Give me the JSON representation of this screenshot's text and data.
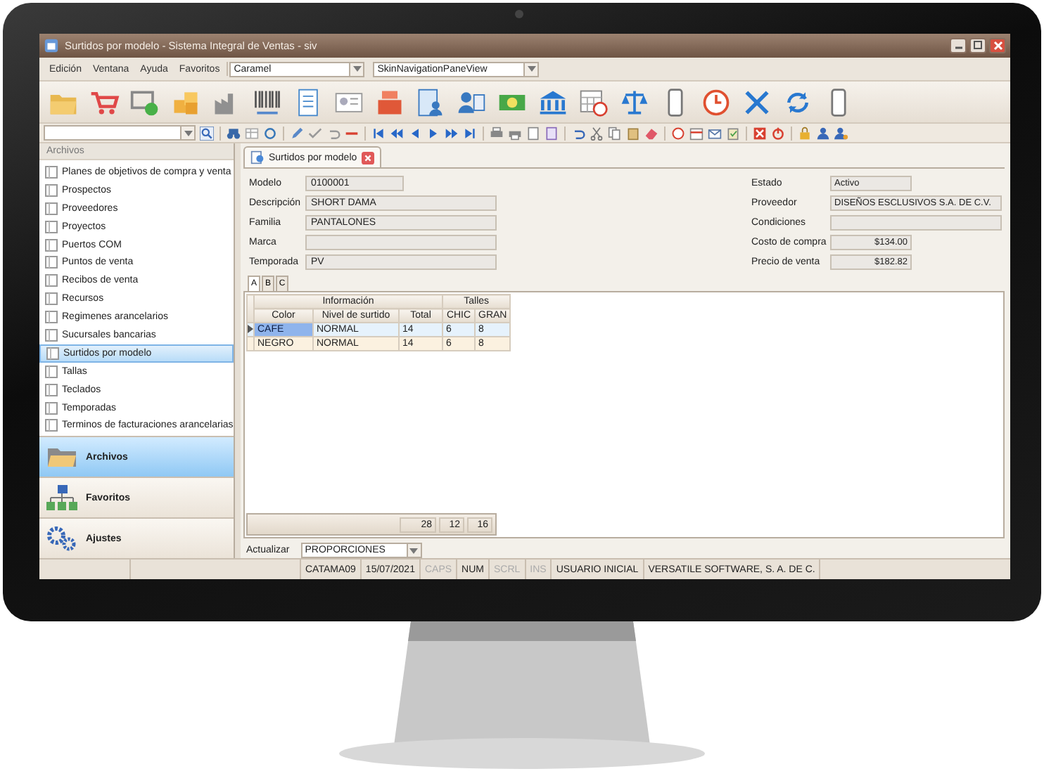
{
  "window": {
    "title": "Surtidos por modelo - Sistema Integral de Ventas - siv"
  },
  "menu": [
    "Edición",
    "Ventana",
    "Ayuda",
    "Favoritos"
  ],
  "skin_combo": {
    "value": "Caramel"
  },
  "view_combo": {
    "value": "SkinNavigationPaneView"
  },
  "sidebar": {
    "header": "Archivos",
    "items": [
      {
        "label": "Planes de objetivos de compra y venta",
        "selected": false
      },
      {
        "label": "Prospectos",
        "selected": false
      },
      {
        "label": "Proveedores",
        "selected": false
      },
      {
        "label": "Proyectos",
        "selected": false
      },
      {
        "label": "Puertos COM",
        "selected": false
      },
      {
        "label": "Puntos de venta",
        "selected": false
      },
      {
        "label": "Recibos de venta",
        "selected": false
      },
      {
        "label": "Recursos",
        "selected": false
      },
      {
        "label": "Regimenes arancelarios",
        "selected": false
      },
      {
        "label": "Sucursales bancarias",
        "selected": false
      },
      {
        "label": "Surtidos por modelo",
        "selected": true
      },
      {
        "label": "Tallas",
        "selected": false
      },
      {
        "label": "Teclados",
        "selected": false
      },
      {
        "label": "Temporadas",
        "selected": false
      },
      {
        "label": "Terminos de facturaciones arancelarias",
        "selected": false
      }
    ]
  },
  "nav_pane": [
    {
      "label": "Archivos",
      "selected": true
    },
    {
      "label": "Favoritos",
      "selected": false
    },
    {
      "label": "Ajustes",
      "selected": false
    }
  ],
  "document_tab": {
    "label": "Surtidos por modelo"
  },
  "form": {
    "left": [
      {
        "label": "Modelo",
        "value": "0100001",
        "kind": "short"
      },
      {
        "label": "Descripción",
        "value": "SHORT DAMA",
        "kind": "wide"
      },
      {
        "label": "Familia",
        "value": "PANTALONES",
        "kind": "wide"
      },
      {
        "label": "Marca",
        "kind": "wide"
      },
      {
        "label": "Temporada",
        "value": "PV",
        "kind": "wide"
      }
    ],
    "right": [
      {
        "label": "Estado",
        "value": "Activo",
        "kind": "short"
      },
      {
        "label": "Proveedor",
        "value": "DISEÑOS ESCLUSIVOS S.A. DE C.V.",
        "kind": "wide"
      },
      {
        "label": "Condiciones",
        "kind": "wide"
      },
      {
        "label": "Costo de compra",
        "value": "$134.00",
        "kind": "amount"
      },
      {
        "label": "Precio de venta",
        "value": "$182.82",
        "kind": "amount"
      }
    ]
  },
  "subtabs": [
    {
      "label": "A",
      "selected": true
    },
    {
      "label": "B",
      "selected": false
    },
    {
      "label": "C",
      "selected": false
    }
  ],
  "grid": {
    "groups": [
      {
        "label": "Información",
        "columns": [
          "Color",
          "Nivel de surtido",
          "Total"
        ]
      },
      {
        "label": "Talles",
        "columns": [
          "CHIC",
          "GRAN"
        ]
      }
    ],
    "rows": [
      {
        "selected": true,
        "cells": [
          "CAFE",
          "NORMAL",
          "14",
          "6",
          "8"
        ]
      },
      {
        "selected": false,
        "cells": [
          "NEGRO",
          "NORMAL",
          "14",
          "6",
          "8"
        ]
      }
    ],
    "totals": [
      "28",
      "12",
      "16"
    ]
  },
  "update": {
    "label": "Actualizar",
    "value": "PROPORCIONES"
  },
  "status_bar": [
    {
      "text": "CATAMA09",
      "disabled": false
    },
    {
      "text": "15/07/2021",
      "disabled": false
    },
    {
      "text": "CAPS",
      "disabled": true
    },
    {
      "text": "NUM",
      "disabled": false
    },
    {
      "text": "SCRL",
      "disabled": true
    },
    {
      "text": "INS",
      "disabled": true
    },
    {
      "text": "USUARIO INICIAL",
      "disabled": false
    },
    {
      "text": "VERSATILE SOFTWARE, S. A. DE C.",
      "disabled": false
    }
  ]
}
